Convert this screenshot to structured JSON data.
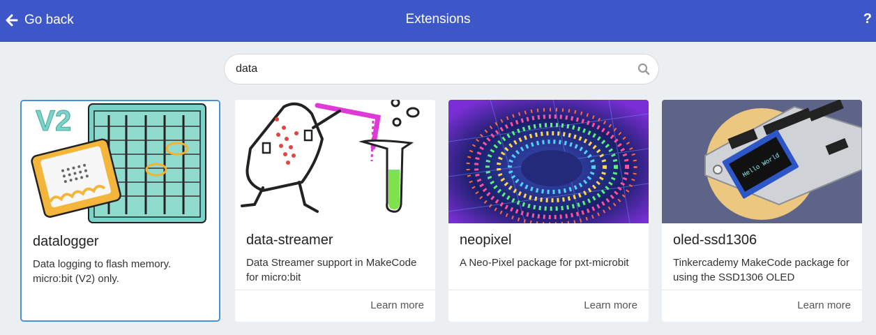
{
  "header": {
    "back_label": "Go back",
    "title": "Extensions",
    "help_label": "?",
    "background_color": "#3d57c9"
  },
  "search": {
    "value": "data",
    "icon": "search-icon"
  },
  "cards": [
    {
      "name": "datalogger",
      "description": "Data logging to flash memory. micro:bit (V2) only.",
      "image_text": "V2",
      "selected": true
    },
    {
      "name": "data-streamer",
      "description": "Data Streamer support in MakeCode for micro:bit",
      "learn_more": "Learn more"
    },
    {
      "name": "neopixel",
      "description": "A Neo-Pixel package for pxt-microbit",
      "learn_more": "Learn more"
    },
    {
      "name": "oled-ssd1306",
      "description": "Tinkercademy MakeCode package for using the SSD1306 OLED",
      "image_text": "Hello World",
      "learn_more": "Learn more"
    }
  ]
}
